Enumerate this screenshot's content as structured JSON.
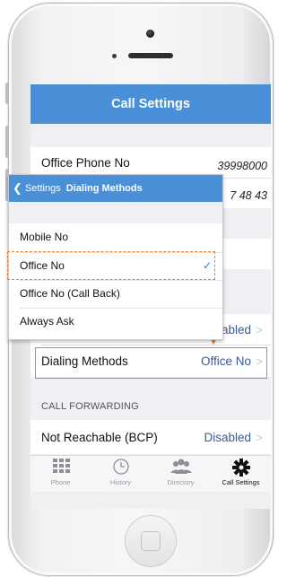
{
  "screen": {
    "title": "Call Settings",
    "rows": {
      "office_phone_label": "Office Phone No",
      "office_phone_value": "39998000",
      "second_value_partial": "7 48 43",
      "disabled_partial": "abled",
      "dialing_methods_label": "Dialing Methods",
      "dialing_methods_value": "Office No",
      "call_forwarding_header": "CALL FORWARDING",
      "not_reachable_label": "Not Reachable (BCP)",
      "not_reachable_value": "Disabled"
    }
  },
  "tabbar": {
    "tabs": [
      {
        "label": "Phone",
        "icon": "keypad-icon"
      },
      {
        "label": "History",
        "icon": "clock-icon"
      },
      {
        "label": "Directory",
        "icon": "contacts-icon"
      },
      {
        "label": "Call Settings",
        "icon": "gear-icon"
      }
    ],
    "active": "Call Settings"
  },
  "popup": {
    "back_label": "Settings",
    "title": "Dialing Methods",
    "options": [
      "Mobile No",
      "Office No",
      "Office No (Call Back)",
      "Always Ask"
    ],
    "selected": "Office No"
  },
  "colors": {
    "nav_blue": "#4a90d9",
    "highlight_orange": "#ef7a2a"
  }
}
